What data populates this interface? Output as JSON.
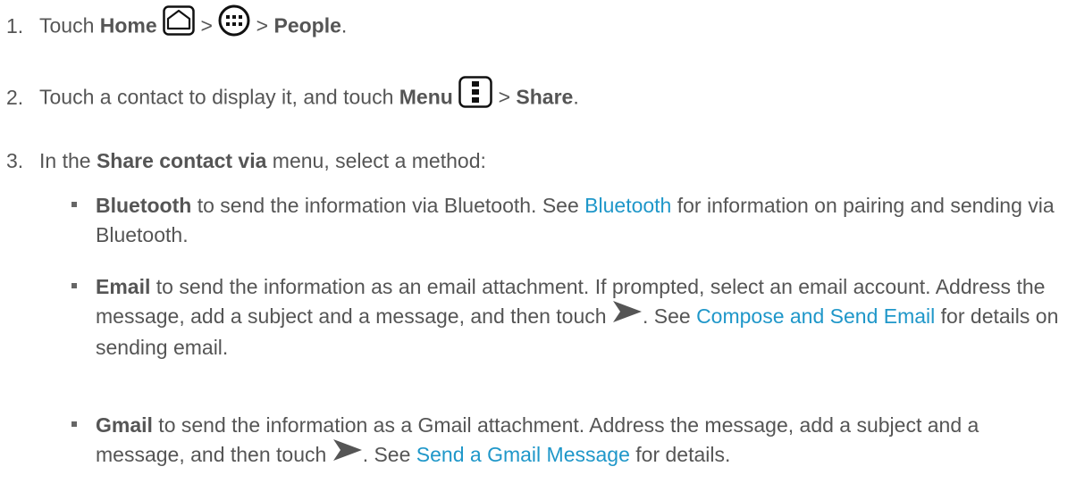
{
  "steps": [
    {
      "num": "1.",
      "t1": "Touch ",
      "home": "Home",
      "sep1": " > ",
      "sep2": " > ",
      "people": "People",
      "end": "."
    },
    {
      "num": "2.",
      "t1": "Touch a contact to display it, and touch ",
      "menu": "Menu",
      "sep1": " > ",
      "share": "Share",
      "end": "."
    },
    {
      "num": "3.",
      "t1": "In the ",
      "share_via": "Share contact via",
      "t2": " menu, select a method:"
    }
  ],
  "bullets": {
    "bluetooth": {
      "term": "Bluetooth",
      "t1": " to send the information via Bluetooth. See ",
      "link": "Bluetooth",
      "t2": " for information on pairing and sending via Bluetooth."
    },
    "email": {
      "term": "Email",
      "t1": " to send the information as an email attachment. If prompted, select an email account. Address the message, add a subject and a message, and then touch ",
      "t2": ". See ",
      "link": "Compose and Send Email",
      "t3": " for details on sending email."
    },
    "gmail": {
      "term": "Gmail",
      "t1": " to send the information as a Gmail attachment. Address the message, add a subject and a message, and then touch ",
      "t2": ". See ",
      "link": "Send a Gmail Message",
      "t3": " for details."
    }
  },
  "colors": {
    "text": "#555555",
    "link": "#1f97c9"
  },
  "icons": [
    "home-icon",
    "apps-icon",
    "menu-icon",
    "send-icon"
  ]
}
